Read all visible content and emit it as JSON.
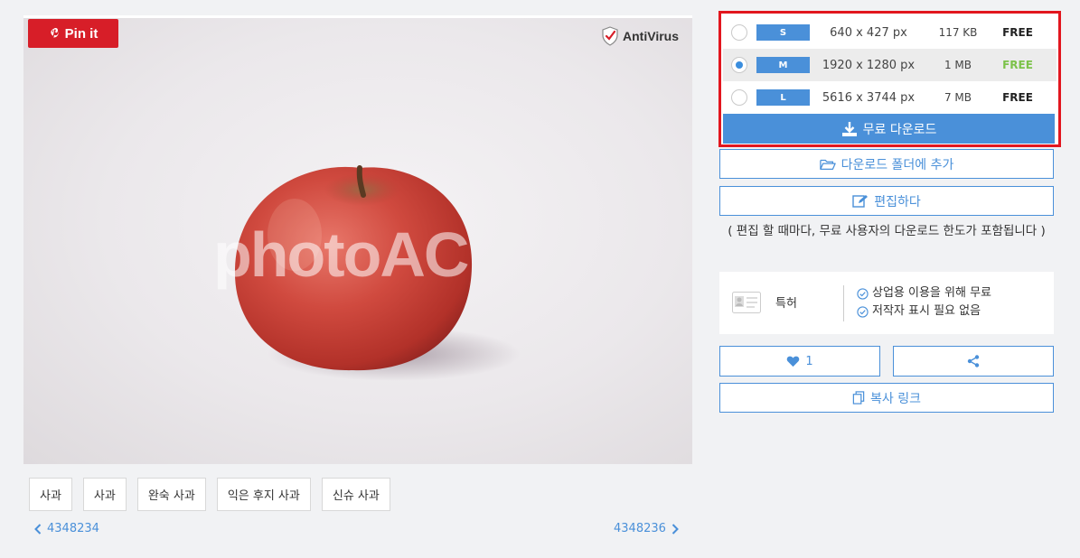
{
  "photo": {
    "pin_label": "Pin it",
    "antivirus_label": "AntiVirus",
    "watermark_text": "photoAC"
  },
  "tags": [
    "사과",
    "사과",
    "완숙 사과",
    "익은 후지 사과",
    "신슈 사과"
  ],
  "nav": {
    "prev_id": "4348234",
    "next_id": "4348236"
  },
  "sizes": [
    {
      "code": "S",
      "dimensions": "640 x 427 px",
      "filesize": "117 KB",
      "price": "FREE",
      "selected": false
    },
    {
      "code": "M",
      "dimensions": "1920 x 1280 px",
      "filesize": "1 MB",
      "price": "FREE",
      "selected": true
    },
    {
      "code": "L",
      "dimensions": "5616 x 3744 px",
      "filesize": "7 MB",
      "price": "FREE",
      "selected": false
    }
  ],
  "download_label": "무료 다운로드",
  "add_folder_label": "다운로드 폴더에 추가",
  "edit_label": "편집하다",
  "edit_note": "( 편집 할 때마다, 무료 사용자의 다운로드 한도가 포함됩니다 )",
  "license": {
    "label": "특허",
    "items": [
      "상업용 이용을 위해 무료",
      "저작자 표시 필요 없음"
    ]
  },
  "like_count": "1",
  "copy_link_label": "복사 링크",
  "colors": {
    "accent": "#4a90d9",
    "highlight_border": "#e2161e",
    "pin_red": "#d71e28",
    "free_green": "#7cc24a"
  }
}
